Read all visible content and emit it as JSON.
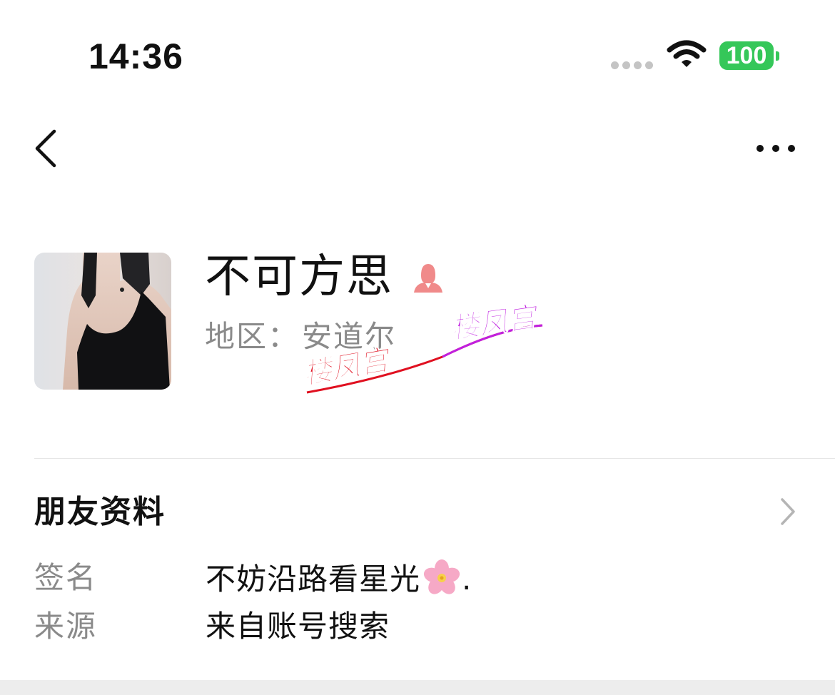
{
  "status_bar": {
    "time": "14:36",
    "battery": "100"
  },
  "nav": {
    "back_icon": "chevron-left-icon",
    "more_icon": "more-dots-icon"
  },
  "profile": {
    "nickname": "不可方思",
    "gender_icon": "female-icon",
    "region_label": "地区：",
    "region_value": "安道尔"
  },
  "watermark": {
    "text": "楼凤宫"
  },
  "friend_info": {
    "title": "朋友资料",
    "rows": [
      {
        "label": "签名",
        "value": "不妨沿路看星光",
        "suffix": "."
      },
      {
        "label": "来源",
        "value": "来自账号搜索"
      }
    ]
  },
  "colors": {
    "battery": "#35c759",
    "secondary_text": "#8a8a8a",
    "gender_icon": "#f08a8a",
    "watermark_red": "#e01020",
    "watermark_purple": "#c020e0"
  }
}
